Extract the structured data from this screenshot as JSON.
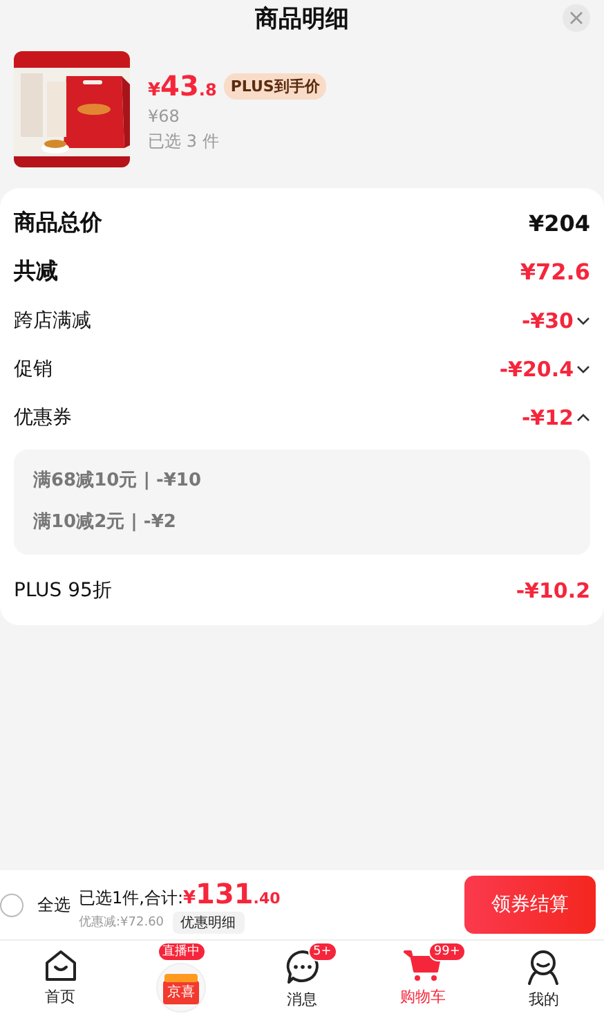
{
  "header": {
    "title": "商品明细"
  },
  "product": {
    "price_symbol": "¥",
    "price_int": "43",
    "price_dec": ".8",
    "plus_badge": "PLUS到手价",
    "original_price": "¥68",
    "selected_count": "已选 3 件"
  },
  "summary": {
    "rows": [
      {
        "label": "商品总价",
        "value": "¥204",
        "kind": "total"
      },
      {
        "label": "共减",
        "value": "¥72.6",
        "kind": "reduction"
      },
      {
        "label": "跨店满减",
        "value": "-¥30",
        "kind": "expandable",
        "expanded": false
      },
      {
        "label": "促销",
        "value": "-¥20.4",
        "kind": "expandable",
        "expanded": false
      },
      {
        "label": "优惠券",
        "value": "-¥12",
        "kind": "expandable",
        "expanded": true,
        "details": [
          "满68减10元 | -¥10",
          "满10减2元 | -¥2"
        ]
      },
      {
        "label": "PLUS 95折",
        "value": "-¥10.2",
        "kind": "plain"
      }
    ]
  },
  "footer": {
    "select_all": {
      "label": "全选",
      "checked": false
    },
    "summary_text": "已选1件,合计:",
    "total_symbol": "¥",
    "total_int": "131",
    "total_dec": ".40",
    "discount": "优惠减:¥72.60",
    "detail_button": "优惠明细",
    "checkout_button": "领券结算"
  },
  "tabbar": [
    {
      "kind": "home",
      "label": "首页",
      "selected": false
    },
    {
      "kind": "live",
      "logo_text": "京喜",
      "badge": "直播中",
      "selected": false
    },
    {
      "kind": "message",
      "label": "消息",
      "badge": "5+",
      "selected": false
    },
    {
      "kind": "cart",
      "label": "购物车",
      "badge": "99+",
      "selected": true
    },
    {
      "kind": "profile",
      "label": "我的",
      "selected": false
    }
  ]
}
